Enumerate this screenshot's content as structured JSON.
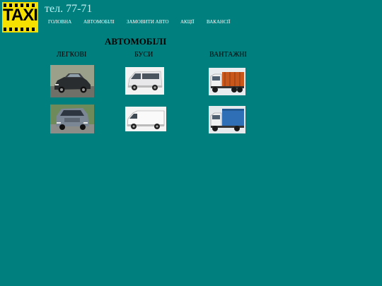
{
  "header": {
    "logo_text": "TAXI",
    "phone": "тел. 77-71"
  },
  "nav": {
    "items": [
      "ГОЛОВНА",
      "АВТОМОБІЛІ",
      "ЗАМОВИТИ АВТО",
      "АКЦІЇ",
      "ВАКАНСІЇ"
    ]
  },
  "main": {
    "title": "АВТОМОБІЛІ",
    "categories": [
      "ЛЕГКОВІ",
      "БУСИ",
      "ВАНТАЖНІ"
    ]
  },
  "colors": {
    "background": "#007f7f",
    "logo": "#f5e000"
  },
  "images": [
    "car-photo",
    "minibus-photo",
    "dump-truck-photo",
    "minivan-photo",
    "cargo-van-photo",
    "box-truck-photo"
  ]
}
